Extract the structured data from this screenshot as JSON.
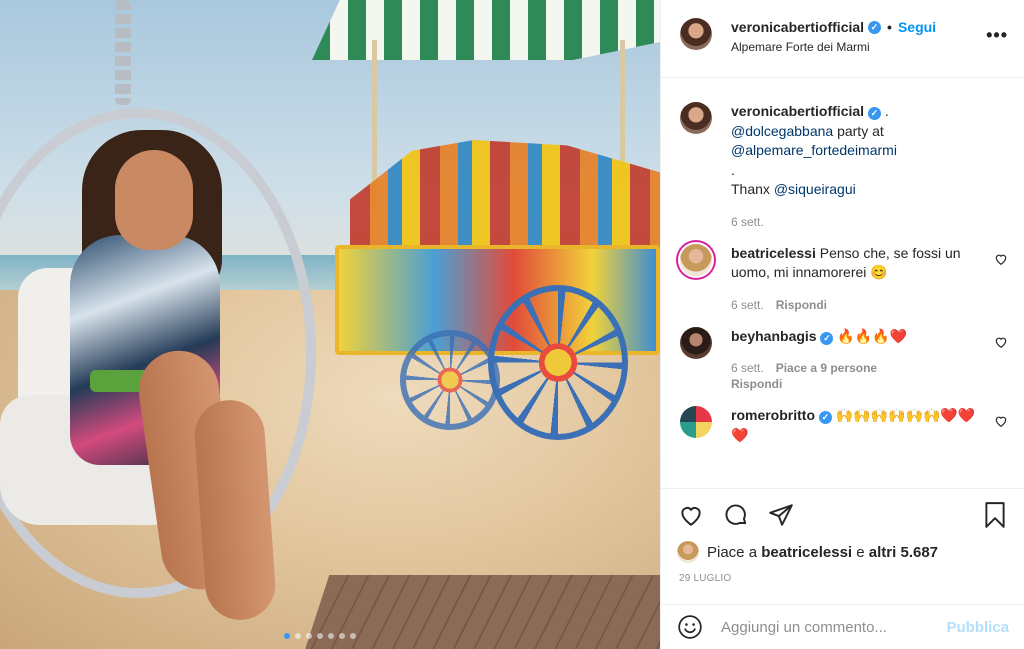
{
  "post": {
    "author": "veronicabertiofficial",
    "follow_label": "Segui",
    "separator": "•",
    "location": "Alpemare Forte dei Marmi",
    "more_icon": "more-options-icon"
  },
  "caption": {
    "author": "veronicabertiofficial",
    "line1": ".",
    "mention1": "@dolcegabbana",
    "line2": " party at",
    "mention2": "@alpemare_fortedeimarmi",
    "line3": ".",
    "line4": "Thanx ",
    "mention3": "@siqueiragui",
    "time": "6 sett."
  },
  "comments": [
    {
      "user": "beatricelessi",
      "text": "Penso che, se fossi un uomo, mi innamorerei 😊",
      "time": "6 sett.",
      "reply": "Rispondi"
    },
    {
      "user": "beyhanbagis",
      "text": "🔥🔥🔥❤️",
      "time": "6 sett.",
      "likes": "Piace a 9 persone",
      "reply": "Rispondi"
    },
    {
      "user": "romerobritto",
      "text": "🙌🙌🙌🙌🙌🙌❤️❤️❤️"
    }
  ],
  "likes": {
    "prefix": "Piace a ",
    "user": "beatricelessi",
    "middle": " e ",
    "others": "altri 5.687"
  },
  "date": "29 LUGLIO",
  "composer": {
    "placeholder": "Aggiungi un commento...",
    "publish_label": "Pubblica"
  },
  "carousel": {
    "count": 7,
    "active_index": 0
  },
  "colors": {
    "accent": "#0095f6",
    "verified": "#3897f0",
    "mention": "#00376b",
    "muted": "#8e8e8e",
    "publish_disabled": "#b2dffc"
  }
}
